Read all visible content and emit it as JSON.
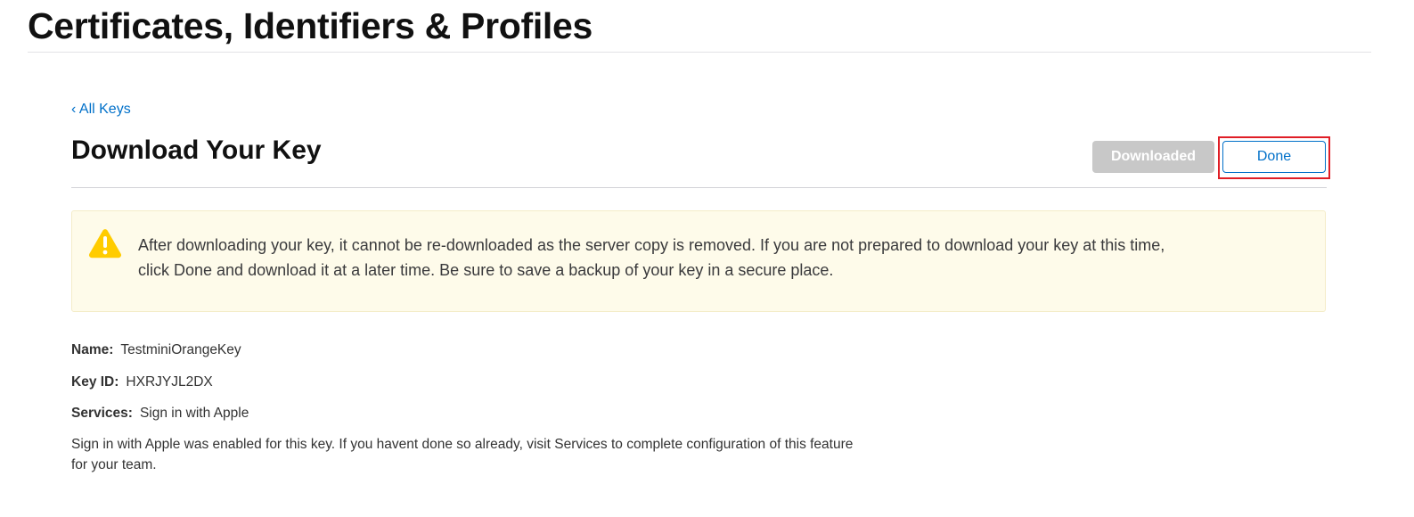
{
  "header": {
    "title": "Certificates, Identifiers & Profiles"
  },
  "nav": {
    "back_link": "‹ All Keys"
  },
  "section": {
    "title": "Download Your Key",
    "downloaded_label": "Downloaded",
    "done_label": "Done"
  },
  "warning": {
    "icon": "warning-triangle-icon",
    "text": "After downloading your key, it cannot be re-downloaded as the server copy is removed. If you are not prepared to download your key at this time, click Done and download it at a later time. Be sure to save a backup of your key in a secure place."
  },
  "details": {
    "name_label": "Name:",
    "name_value": "TestminiOrangeKey",
    "keyid_label": "Key ID:",
    "keyid_value": "HXRJYJL2DX",
    "services_label": "Services:",
    "services_value": "Sign in with Apple"
  },
  "info": {
    "text": "Sign in with Apple was enabled for this key. If you havent done so already, visit Services to complete configuration of this feature for your team."
  },
  "colors": {
    "link_blue": "#0070c9",
    "warning_yellow": "#ffcc00",
    "highlight_red": "#e01e26",
    "disabled_gray": "#c8c8c8"
  }
}
